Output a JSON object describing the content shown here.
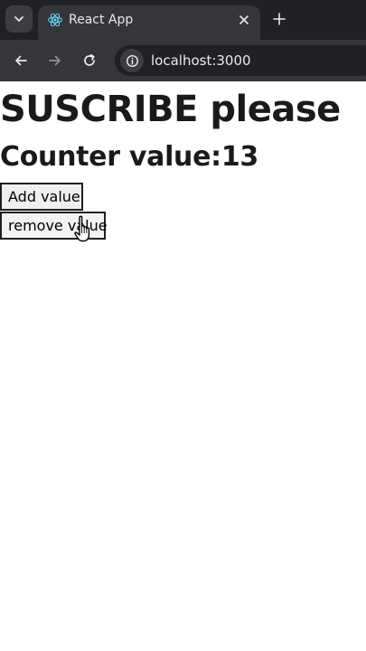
{
  "browser": {
    "tab": {
      "title": "React App",
      "favicon_icon": "react-logo-icon"
    },
    "address_bar": {
      "url": "localhost:3000"
    },
    "colors": {
      "tabbar_bg": "#202124",
      "toolbar_bg": "#35363a",
      "text": "#e8eaed",
      "react_blue": "#61dafb"
    }
  },
  "page": {
    "title": "SUSCRIBE please",
    "counter_text": "Counter value:13",
    "buttons": {
      "add_label": "Add value",
      "remove_label": "remove value"
    }
  }
}
